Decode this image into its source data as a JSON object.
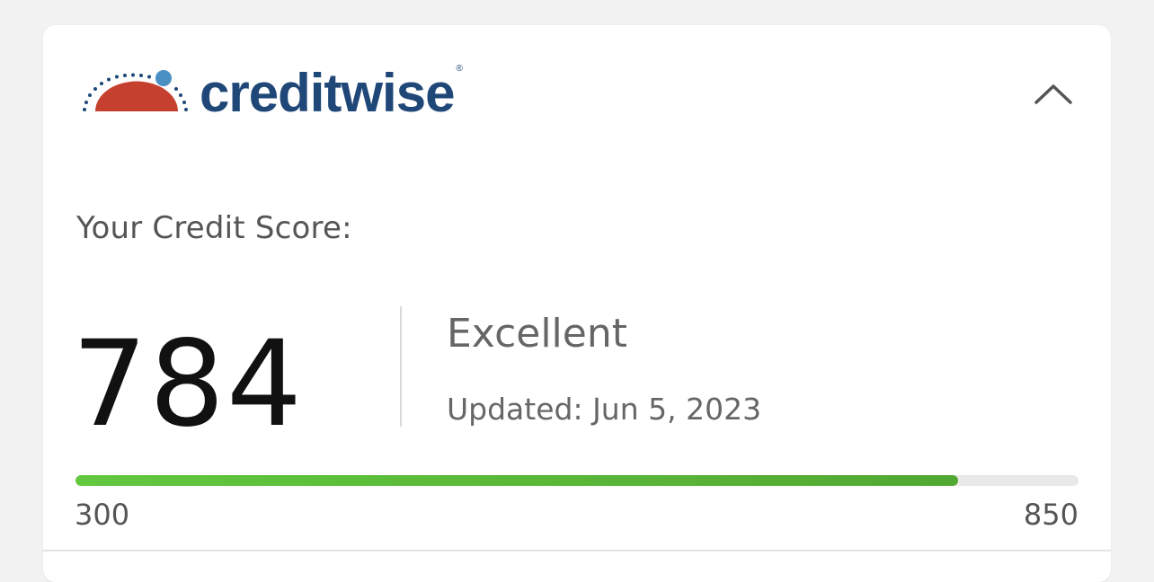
{
  "logo": {
    "wordmark": "creditwise",
    "registered": "®",
    "colors": {
      "arc": "#c6402f",
      "dots": "#1f4777",
      "accent_dot": "#4a90c2",
      "wordmark": "#1f4777"
    }
  },
  "header": {
    "collapse_icon": "chevron-up-icon"
  },
  "score": {
    "label": "Your Credit Score:",
    "value": "784",
    "rating": "Excellent",
    "updated": "Updated: Jun 5, 2023"
  },
  "range": {
    "min": "300",
    "max": "850",
    "progress": 0.88,
    "colors": {
      "fill_start": "#62c83e",
      "fill_end": "#52a832",
      "track": "#e9e9e9"
    }
  }
}
